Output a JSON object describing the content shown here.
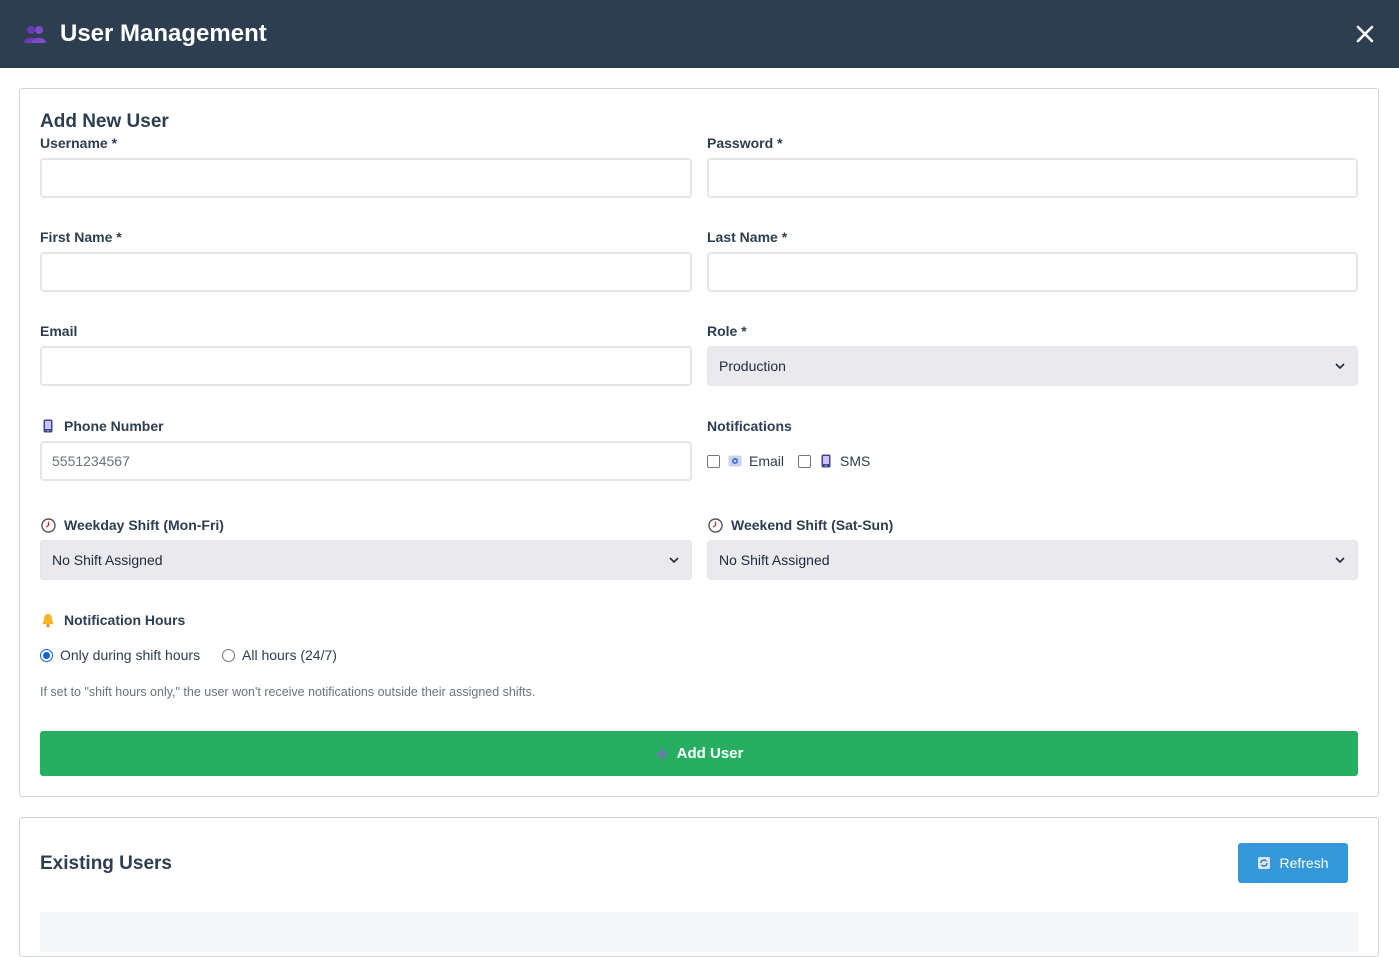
{
  "window": {
    "title": "User Management",
    "icon": "users-icon",
    "close_icon": "close-icon"
  },
  "add_user": {
    "heading": "Add New User",
    "username": {
      "label": "Username *",
      "value": ""
    },
    "password": {
      "label": "Password *",
      "value": ""
    },
    "first_name": {
      "label": "First Name *",
      "value": ""
    },
    "last_name": {
      "label": "Last Name *",
      "value": ""
    },
    "email": {
      "label": "Email",
      "value": ""
    },
    "role": {
      "label": "Role *",
      "selected": "Production"
    },
    "phone": {
      "label": "Phone Number",
      "icon": "mobile-phone-icon",
      "value": "5551234567"
    },
    "notifications": {
      "label": "Notifications",
      "options": [
        {
          "label": "Email",
          "icon": "email-icon",
          "checked": false
        },
        {
          "label": "SMS",
          "icon": "mobile-phone-icon",
          "checked": false
        }
      ]
    },
    "weekday_shift": {
      "label": "Weekday Shift (Mon-Fri)",
      "icon": "clock-icon",
      "selected": "No Shift Assigned"
    },
    "weekend_shift": {
      "label": "Weekend Shift (Sat-Sun)",
      "icon": "clock-icon",
      "selected": "No Shift Assigned"
    },
    "notification_hours": {
      "label": "Notification Hours",
      "icon": "bell-icon",
      "options": [
        {
          "label": "Only during shift hours",
          "checked": true
        },
        {
          "label": "All hours (24/7)",
          "checked": false
        }
      ],
      "hint": "If set to \"shift hours only,\" the user won't receive notifications outside their assigned shifts."
    },
    "submit_label": "Add User",
    "submit_icon": "plus-icon"
  },
  "existing_users": {
    "heading": "Existing Users",
    "refresh_label": "Refresh",
    "refresh_icon": "refresh-icon"
  },
  "colors": {
    "header_bg": "#2c3e50",
    "add_button": "#27ae60",
    "refresh_button": "#3498db",
    "radio_accent": "#0b63ce"
  }
}
